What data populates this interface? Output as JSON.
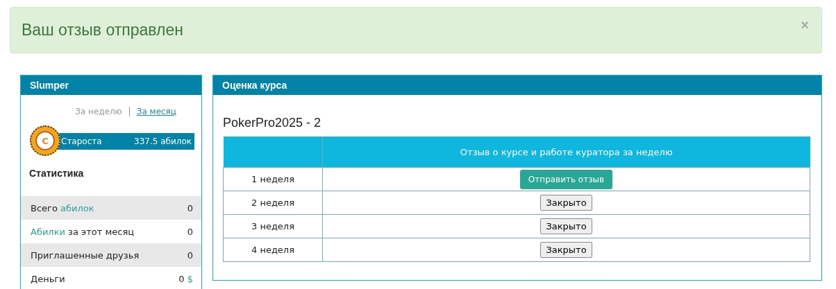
{
  "alert": {
    "message": "Ваш отзыв отправлен",
    "close": "×"
  },
  "sidebar": {
    "title": "Slumper",
    "periods": [
      {
        "label": "За неделю",
        "selected": true
      },
      {
        "label": "За месяц",
        "selected": false
      }
    ],
    "rank": {
      "coin_letter": "C",
      "title": "Староста",
      "points": "337.5 абилок"
    },
    "stats_title": "Статистика",
    "stats": [
      {
        "label": [
          {
            "text": "Всего ",
            "link": false
          },
          {
            "text": "абилок",
            "link": true
          }
        ],
        "value": [
          {
            "text": "0",
            "link": false
          }
        ]
      },
      {
        "label": [
          {
            "text": "Абилки",
            "link": true
          },
          {
            "text": " за этот месяц",
            "link": false
          }
        ],
        "value": [
          {
            "text": "0",
            "link": false
          }
        ]
      },
      {
        "label": [
          {
            "text": "Приглашенные друзья",
            "link": false
          }
        ],
        "value": [
          {
            "text": "0",
            "link": false
          }
        ]
      },
      {
        "label": [
          {
            "text": "Деньги",
            "link": false
          }
        ],
        "value": [
          {
            "text": "0 ",
            "link": false
          },
          {
            "text": "$",
            "link": true
          }
        ]
      }
    ]
  },
  "main": {
    "title": "Оценка курса",
    "course": "PokerPro2025 - 2",
    "table": {
      "columns": [
        "Отзыв о курсе и работе куратора за неделю"
      ],
      "rows": [
        {
          "week": "1 неделя",
          "action": {
            "kind": "submit",
            "label": "Отправить отзыв"
          }
        },
        {
          "week": "2 неделя",
          "action": {
            "kind": "closed",
            "label": "Закрыто"
          }
        },
        {
          "week": "3 неделя",
          "action": {
            "kind": "closed",
            "label": "Закрыто"
          }
        },
        {
          "week": "4 неделя",
          "action": {
            "kind": "closed",
            "label": "Закрыто"
          }
        }
      ]
    }
  }
}
